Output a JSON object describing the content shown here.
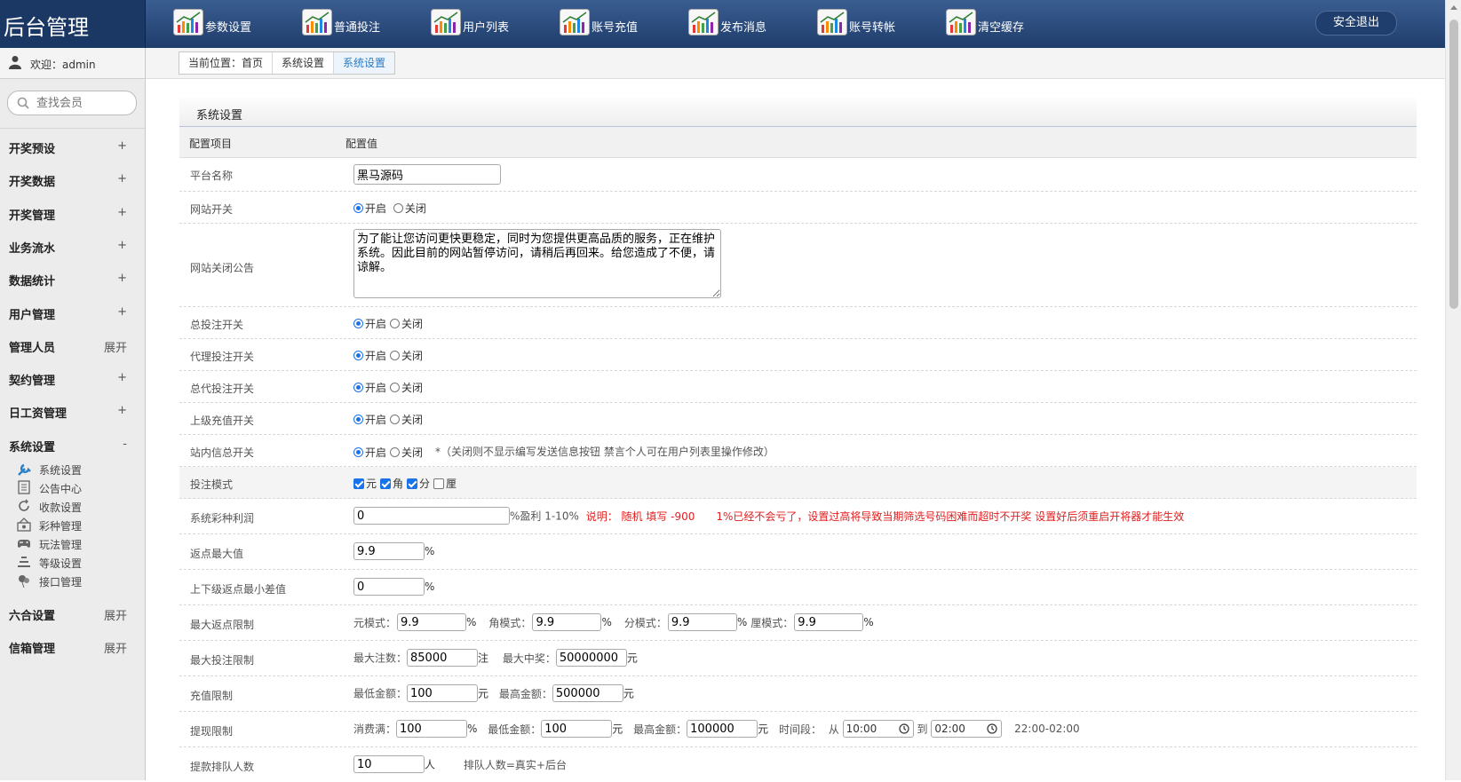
{
  "header": {
    "brand": "后台管理",
    "nav": [
      "参数设置",
      "普通投注",
      "用户列表",
      "账号充值",
      "发布消息",
      "账号转帐",
      "清空缓存"
    ],
    "logout": "安全退出"
  },
  "sidebar": {
    "welcome": "欢迎：admin",
    "search_placeholder": "查找会员",
    "menu": [
      {
        "label": "开奖预设",
        "toggle": "+"
      },
      {
        "label": "开奖数据",
        "toggle": "+"
      },
      {
        "label": "开奖管理",
        "toggle": "+"
      },
      {
        "label": "业务流水",
        "toggle": "+"
      },
      {
        "label": "数据统计",
        "toggle": "+"
      },
      {
        "label": "用户管理",
        "toggle": "+"
      },
      {
        "label": "管理人员",
        "toggle": "展开"
      },
      {
        "label": "契约管理",
        "toggle": "+"
      },
      {
        "label": "日工资管理",
        "toggle": "+"
      },
      {
        "label": "系统设置",
        "toggle": "-"
      }
    ],
    "submenu": [
      {
        "label": "系统设置",
        "icon": "wrench-icon"
      },
      {
        "label": "公告中心",
        "icon": "document-icon"
      },
      {
        "label": "收款设置",
        "icon": "refresh-icon"
      },
      {
        "label": "彩种管理",
        "icon": "lottery-icon"
      },
      {
        "label": "玩法管理",
        "icon": "gamepad-icon"
      },
      {
        "label": "等级设置",
        "icon": "levels-icon"
      },
      {
        "label": "接口管理",
        "icon": "balloon-icon"
      }
    ],
    "menu_after": [
      {
        "label": "六合设置",
        "toggle": "展开"
      },
      {
        "label": "信箱管理",
        "toggle": "展开"
      }
    ]
  },
  "breadcrumb": [
    "当前位置：首页",
    "系统设置",
    "系统设置"
  ],
  "panel": {
    "title": "系统设置",
    "col_item": "配置项目",
    "col_value": "配置值"
  },
  "on": "开启",
  "off": "关闭",
  "rows": {
    "platform_name": {
      "label": "平台名称",
      "value": "黑马源码"
    },
    "site_switch": {
      "label": "网站开关"
    },
    "close_notice": {
      "label": "网站关闭公告",
      "value": "为了能让您访问更快更稳定，同时为您提供更高品质的服务，正在维护系统。因此目前的网站暂停访问，请稍后再回来。给您造成了不便，请谅解。"
    },
    "bet_switch": {
      "label": "总投注开关"
    },
    "agent_bet_switch": {
      "label": "代理投注开关"
    },
    "general_agent_bet_switch": {
      "label": "总代投注开关"
    },
    "upper_recharge_switch": {
      "label": "上级充值开关"
    },
    "message_switch": {
      "label": "站内信总开关",
      "note": "*（关闭则不显示编写发送信息按钮 禁言个人可在用户列表里操作修改）"
    },
    "bet_mode": {
      "label": "投注模式",
      "options": [
        {
          "text": "元",
          "checked": true
        },
        {
          "text": "角",
          "checked": true
        },
        {
          "text": "分",
          "checked": true
        },
        {
          "text": "厘",
          "checked": false
        }
      ]
    },
    "profit": {
      "label": "系统彩种利润",
      "value": "0",
      "suffix": "%盈利 1-10%",
      "note": "说明： 随机 填写 -900　　1%已经不会亏了，设置过高将导致当期筛选号码困难而超时不开奖 设置好后须重启开将器才能生效"
    },
    "rebate_max": {
      "label": "返点最大值",
      "value": "9.9",
      "suffix": "%"
    },
    "rebate_diff": {
      "label": "上下级返点最小差值",
      "value": "0",
      "suffix": "%"
    },
    "max_rebate_limit": {
      "label": "最大返点限制",
      "modes": [
        {
          "label": "元模式：",
          "value": "9.9"
        },
        {
          "label": "角模式：",
          "value": "9.9"
        },
        {
          "label": "分模式：",
          "value": "9.9"
        },
        {
          "label": "厘模式：",
          "value": "9.9"
        }
      ],
      "suffix": "%"
    },
    "max_bet_limit": {
      "label": "最大投注限制",
      "count_label": "最大注数：",
      "count": "85000",
      "count_unit": "注",
      "prize_label": "最大中奖：",
      "prize": "50000000",
      "prize_unit": "元"
    },
    "recharge_limit": {
      "label": "充值限制",
      "min_label": "最低金额：",
      "min": "100",
      "max_label": "最高金额：",
      "max": "500000",
      "unit": "元"
    },
    "withdraw_limit": {
      "label": "提现限制",
      "consume_label": "消费满：",
      "consume": "100",
      "pct": "%",
      "min_label": "最低金额：",
      "min": "100",
      "max_label": "最高金额：",
      "max": "100000",
      "unit": "元",
      "period_label": "时间段：",
      "from_label": "从",
      "from": "10:00",
      "to_label": "到",
      "to": "02:00",
      "range": "22:00-02:00"
    },
    "queue": {
      "label": "提款排队人数",
      "value": "10",
      "suffix": "人",
      "note": "排队人数=真实+后台"
    }
  }
}
